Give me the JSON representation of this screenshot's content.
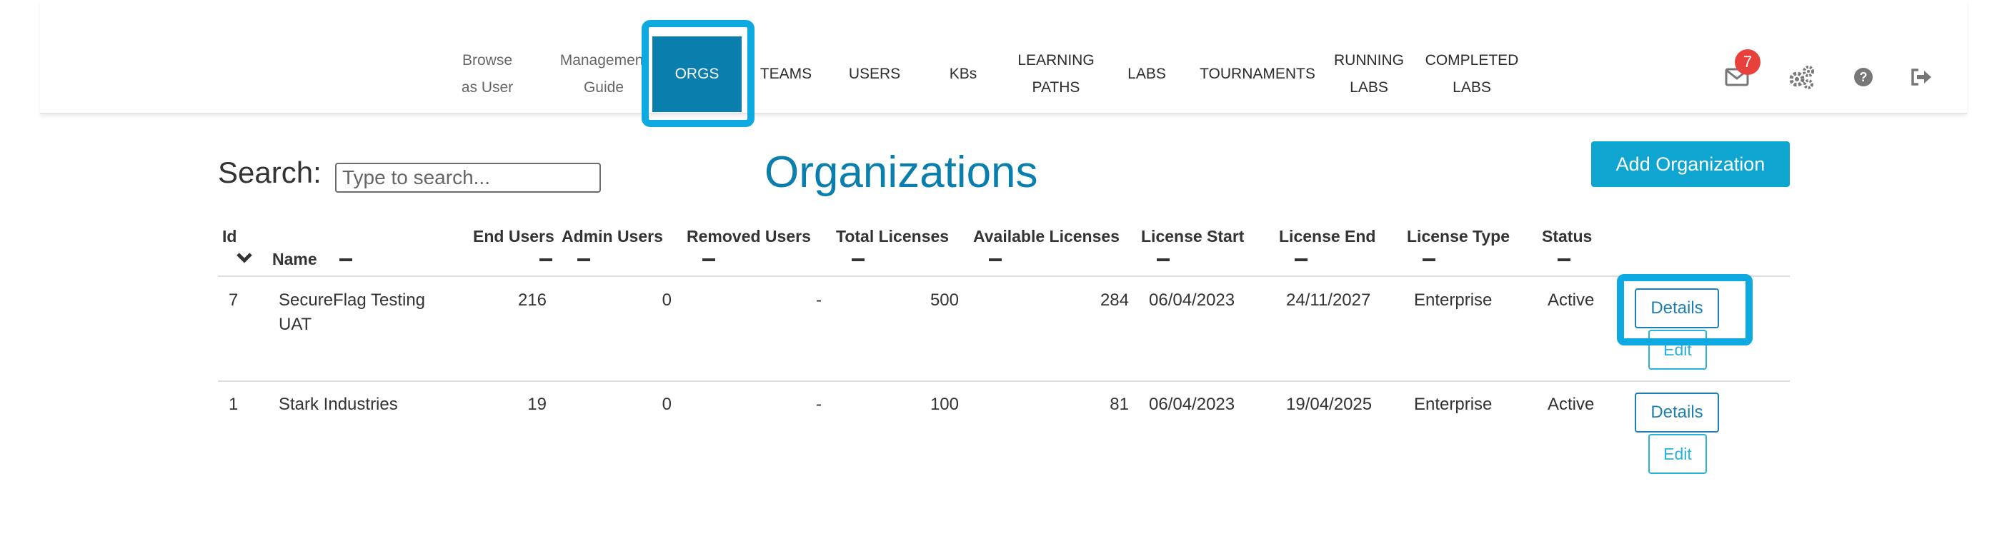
{
  "nav": {
    "browse": [
      "Browse",
      "as User"
    ],
    "management": [
      "Management",
      "Guide"
    ],
    "orgs": "ORGS",
    "teams": "TEAMS",
    "users": "USERS",
    "kbs": "KBs",
    "learning_paths": [
      "LEARNING",
      "PATHS"
    ],
    "labs": "LABS",
    "tournaments": "TOURNAMENTS",
    "running_labs": [
      "RUNNING",
      "LABS"
    ],
    "completed_labs": [
      "COMPLETED",
      "LABS"
    ]
  },
  "notifications": {
    "count": "7"
  },
  "icons": [
    "mail-icon",
    "gear-icon",
    "help-icon",
    "logout-icon",
    "chevron-down-icon"
  ],
  "search": {
    "label": "Search:",
    "placeholder": "Type to search..."
  },
  "page": {
    "title": "Organizations",
    "add_button": "Add Organization"
  },
  "table": {
    "headers": {
      "id": "Id",
      "name": "Name",
      "end_users": "End Users",
      "admin_users": "Admin Users",
      "removed_users": "Removed Users",
      "total_licenses": "Total Licenses",
      "available_licenses": "Available Licenses",
      "license_start": "License Start",
      "license_end": "License End",
      "license_type": "License Type",
      "status": "Status"
    },
    "rows": [
      {
        "id": "7",
        "name": [
          "SecureFlag Testing",
          "UAT"
        ],
        "end_users": "216",
        "admin_users": "0",
        "removed_users": "-",
        "total_licenses": "500",
        "available_licenses": "284",
        "license_start": "06/04/2023",
        "license_end": "24/11/2027",
        "license_type": "Enterprise",
        "status": "Active",
        "details_label": "Details",
        "edit_label": "Edit"
      },
      {
        "id": "1",
        "name": [
          "Stark Industries"
        ],
        "end_users": "19",
        "admin_users": "0",
        "removed_users": "-",
        "total_licenses": "100",
        "available_licenses": "81",
        "license_start": "06/04/2023",
        "license_end": "19/04/2025",
        "license_type": "Enterprise",
        "status": "Active",
        "details_label": "Details",
        "edit_label": "Edit"
      }
    ]
  },
  "colors": {
    "accent": "#0a7fae",
    "highlight": "#0da9e0",
    "badge": "#e8413b",
    "add_button": "#0ea5d0"
  }
}
